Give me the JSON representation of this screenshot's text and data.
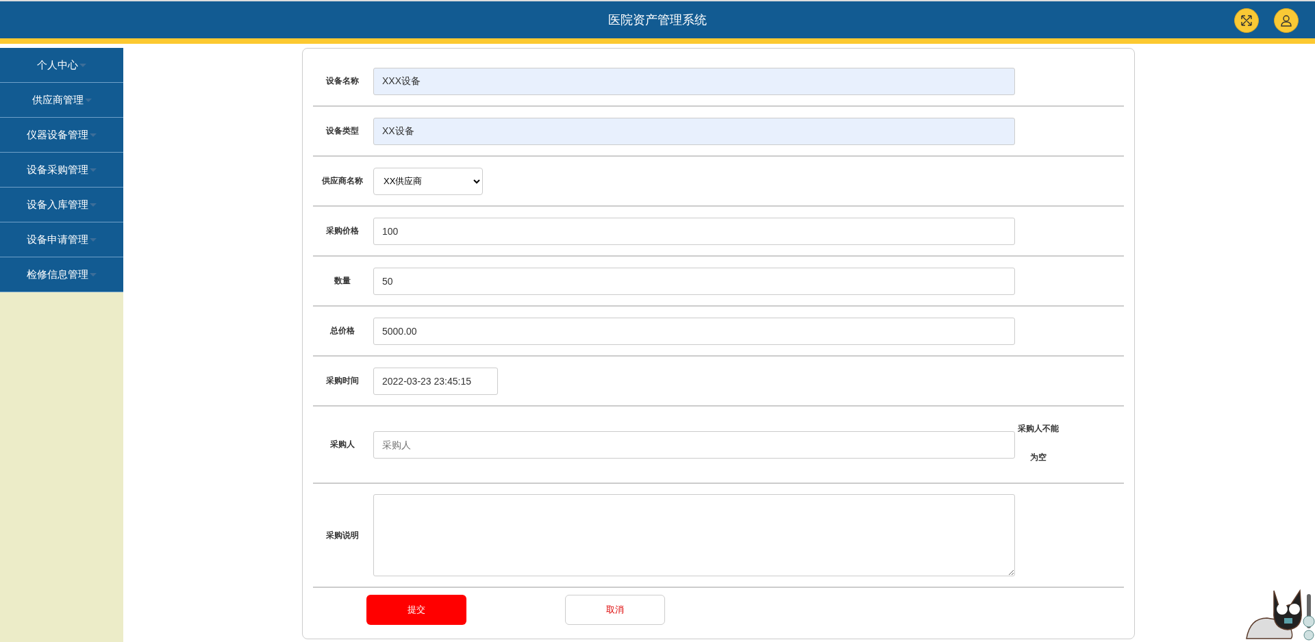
{
  "header": {
    "title": "医院资产管理系统"
  },
  "sidebar": {
    "items": [
      {
        "label": "个人中心"
      },
      {
        "label": "供应商管理"
      },
      {
        "label": "仪器设备管理"
      },
      {
        "label": "设备采购管理"
      },
      {
        "label": "设备入库管理"
      },
      {
        "label": "设备申请管理"
      },
      {
        "label": "检修信息管理"
      }
    ]
  },
  "form": {
    "fields": [
      {
        "kind": "input",
        "label": "设备名称",
        "value": "XXX设备",
        "autofill": true
      },
      {
        "kind": "input",
        "label": "设备类型",
        "value": "XX设备",
        "autofill": true
      },
      {
        "kind": "select",
        "label": "供应商名称",
        "value": "XX供应商"
      },
      {
        "kind": "input",
        "label": "采购价格",
        "value": "100",
        "autofill": false
      },
      {
        "kind": "input",
        "label": "数量",
        "value": "50",
        "autofill": false
      },
      {
        "kind": "input",
        "label": "总价格",
        "value": "5000.00",
        "autofill": false
      },
      {
        "kind": "date",
        "label": "采购时间",
        "value": "2022-03-23 23:45:15"
      },
      {
        "kind": "input",
        "label": "采购人",
        "placeholder": "采购人",
        "autofill": false,
        "error": "采购人不能为空"
      },
      {
        "kind": "textarea",
        "label": "采购说明"
      }
    ],
    "buttons": [
      {
        "kind": "primary",
        "label": "提交"
      },
      {
        "kind": "secondary",
        "label": "取消"
      }
    ]
  }
}
